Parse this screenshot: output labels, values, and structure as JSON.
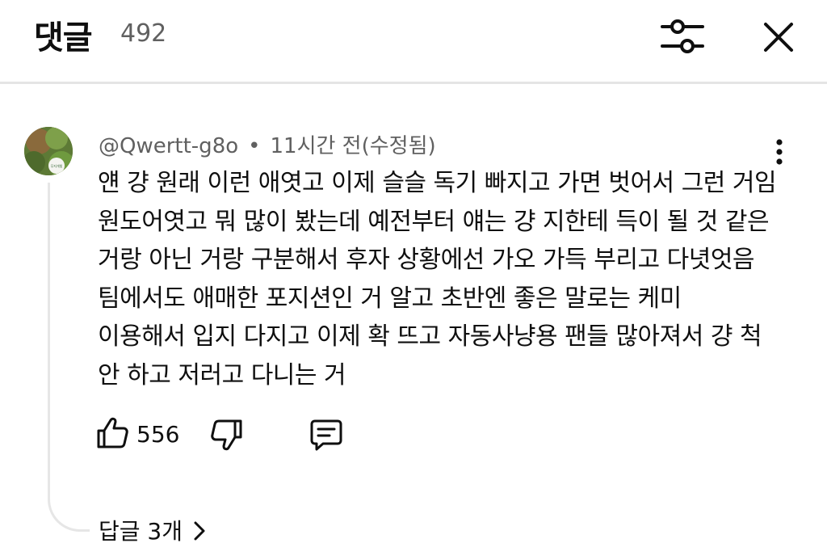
{
  "header": {
    "title": "댓글",
    "count": "492",
    "icons": {
      "filter": "sliders-icon",
      "close": "close-icon"
    }
  },
  "comment": {
    "author": "@Qwertt-g8o",
    "separator": "•",
    "time": "11시간 전(수정됨)",
    "lines": [
      "얜 걍 원래 이런 애엿고 이제 슬슬 독기 빠지고 가면 벗어서 그런 거임",
      "원도어엿고 뭐 많이 봤는데 예전부터 얘는 걍 지한테 득이 될 것 같은",
      "거랑 아닌 거랑 구분해서 후자 상황에선 가오 가득 부리고 다녓엇음",
      "팀에서도 애매한 포지션인 거 알고 초반엔 좋은 말로는 케미",
      "이용해서 입지 다지고 이제 확 뜨고 자동사냥용 팬들 많아져서 걍 척",
      "안 하고 저러고 다니는 거"
    ],
    "likes": "556",
    "replies_label": "답글 3개",
    "avatar_badge": "무지개빛"
  },
  "colors": {
    "secondary_text": "#606060",
    "divider": "#e5e5e5"
  }
}
